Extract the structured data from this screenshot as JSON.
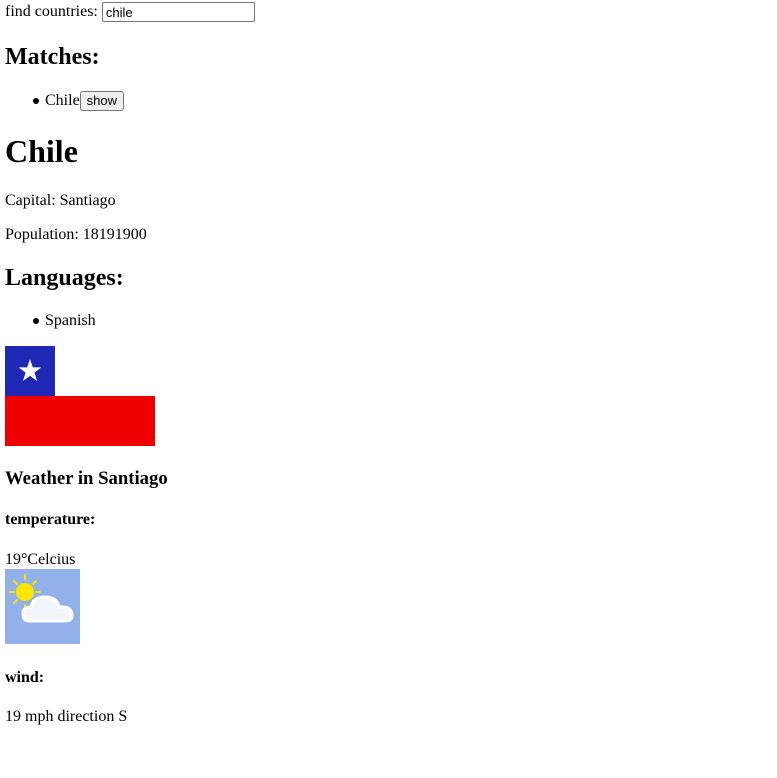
{
  "search": {
    "label": "find countries:",
    "value": "chile"
  },
  "matches": {
    "heading": "Matches:",
    "items": [
      {
        "name": "Chile",
        "button_label": "show"
      }
    ]
  },
  "country": {
    "name": "Chile",
    "capital_label": "Capital:",
    "capital": "Santiago",
    "population_label": "Population:",
    "population": "18191900",
    "languages_heading": "Languages:",
    "languages": [
      "Spanish"
    ],
    "flag_icon": "flag-of-chile",
    "flag_colors": {
      "blue": "#1e28b4",
      "white": "#ffffff",
      "red": "#ee0000"
    }
  },
  "weather": {
    "heading": "Weather in Santiago",
    "temperature_label": "temperature:",
    "temperature": "19°Celcius",
    "icon": "partly-cloudy-icon",
    "icon_bg": "#92b0ea",
    "wind_label": "wind:",
    "wind": "19 mph direction S"
  }
}
